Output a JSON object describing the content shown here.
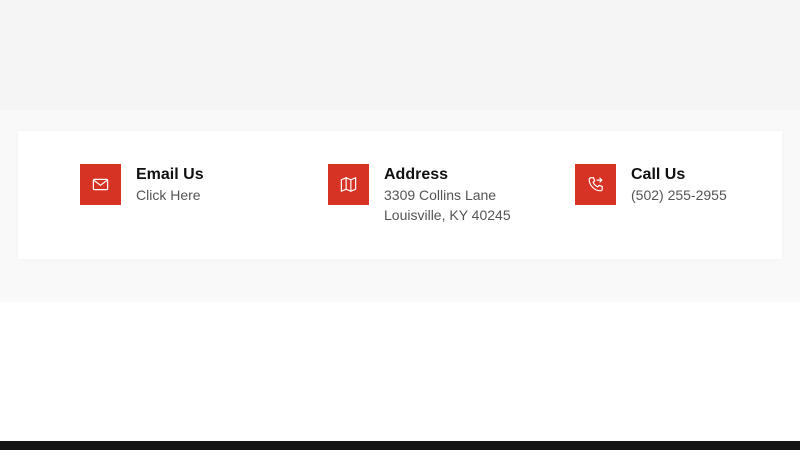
{
  "colors": {
    "accent": "#d63324",
    "footer": "#141414"
  },
  "contact": {
    "email": {
      "icon": "mail-icon",
      "title": "Email Us",
      "link_label": "Click Here"
    },
    "address": {
      "icon": "map-icon",
      "title": "Address",
      "line1": "3309 Collins Lane",
      "line2": "Louisville, KY 40245"
    },
    "call": {
      "icon": "phone-forward-icon",
      "title": "Call Us",
      "phone": "(502) 255-2955"
    }
  }
}
